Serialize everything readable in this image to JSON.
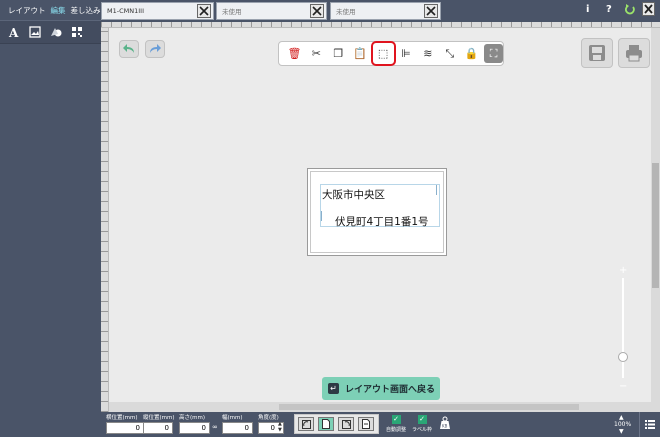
{
  "left_tabs": [
    "レイアウト",
    "編集",
    "差し込み"
  ],
  "active_left_tab": "編集",
  "left_tools": [
    "text-icon",
    "image-icon",
    "shape-icon",
    "barcode-icon"
  ],
  "tabs": [
    {
      "label": "M1-CMN1III",
      "active": true
    },
    {
      "label": "未使用",
      "active": false
    },
    {
      "label": "未使用",
      "active": false
    }
  ],
  "top_right": {
    "info": "i",
    "help": "?",
    "exit": "⮌"
  },
  "toolbar": [
    {
      "name": "delete-icon",
      "glyph": "🗑",
      "color": "#d11a1a"
    },
    {
      "name": "cut-icon",
      "glyph": "✂",
      "color": "#333333"
    },
    {
      "name": "copy-icon",
      "glyph": "❐",
      "color": "#333333"
    },
    {
      "name": "paste-icon",
      "glyph": "📋",
      "color": "#333333"
    },
    {
      "name": "select-area-icon",
      "glyph": "⬚",
      "color": "#333333",
      "highlight": true
    },
    {
      "name": "align-icon",
      "glyph": "⊫",
      "color": "#333333"
    },
    {
      "name": "layers-icon",
      "glyph": "≋",
      "color": "#333333"
    },
    {
      "name": "resize-icon",
      "glyph": "⤡",
      "color": "#333333"
    },
    {
      "name": "lock-icon",
      "glyph": "🔒",
      "color": "#5a3a1a"
    },
    {
      "name": "transform-icon",
      "glyph": "⛶",
      "color": "#ffffff"
    }
  ],
  "label": {
    "line1": "大阪市中央区",
    "line2": "伏見町4丁目1番1号"
  },
  "zoom": {
    "plus": "+",
    "minus": "−",
    "level": "100%"
  },
  "back_button": "レイアウト画面へ戻る",
  "status": {
    "fields": [
      {
        "label": "横位置(mm)",
        "value": "0"
      },
      {
        "label": "縦位置(mm)",
        "value": "0"
      },
      {
        "label": "高さ(mm)",
        "value": "0"
      },
      {
        "label": "幅(mm)",
        "value": "0"
      },
      {
        "label": "角度(度)",
        "value": "0"
      }
    ],
    "checks": [
      {
        "label": "自動調整"
      },
      {
        "label": "ラベル枠"
      }
    ]
  },
  "colors": {
    "accent": "#7dd0b6",
    "highlight": "#e0141e",
    "panel": "#4a5468",
    "active_tab_text": "#8be0f0"
  }
}
